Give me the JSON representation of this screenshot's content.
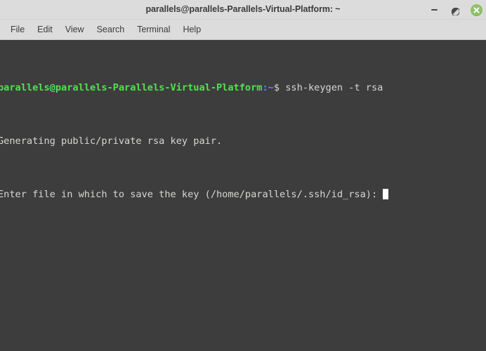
{
  "window": {
    "title": "parallels@parallels-Parallels-Virtual-Platform: ~",
    "controls": {
      "minimize_label": "Minimize",
      "maximize_label": "Restore",
      "close_label": "Close",
      "close_glyph": "✕",
      "close_color": "#8fc06a"
    }
  },
  "menubar": {
    "items": [
      {
        "label": "File"
      },
      {
        "label": "Edit"
      },
      {
        "label": "View"
      },
      {
        "label": "Search"
      },
      {
        "label": "Terminal"
      },
      {
        "label": "Help"
      }
    ]
  },
  "terminal": {
    "background_color": "#3d3d3d",
    "foreground_color": "#d6d8d3",
    "prompt_color": "#4ee44e",
    "path_color": "#5f87ff",
    "lines": [
      {
        "type": "prompt",
        "user_host": "parallels@parallels-Parallels-Virtual-Platform",
        "separator": ":",
        "path": "~",
        "sigil": "$",
        "command": " ssh-keygen -t rsa"
      },
      {
        "type": "output",
        "text": "Generating public/private rsa key pair."
      },
      {
        "type": "input-prompt",
        "text": "Enter file in which to save the key (/home/parallels/.ssh/id_rsa): "
      }
    ]
  }
}
